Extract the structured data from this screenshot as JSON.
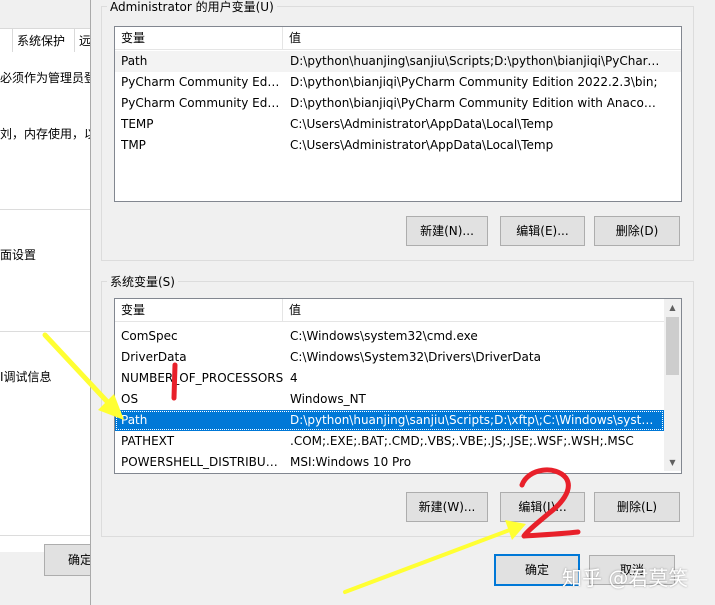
{
  "background_window": {
    "tabs": [
      "",
      "系统保护",
      "远"
    ],
    "admin_notice": "必须作为管理员登",
    "perf_text": "刘，内存使用，以",
    "profile_text": "面设置",
    "debug_text": "I调试信息",
    "ok_label": "确定"
  },
  "user_vars": {
    "title": "Administrator 的用户变量(U)",
    "headers": [
      "变量",
      "值"
    ],
    "rows": [
      {
        "name": "Path",
        "value": "D:\\python\\huanjing\\sanjiu\\Scripts;D:\\python\\bianjiqi\\PyCharm..."
      },
      {
        "name": "PyCharm Community Editi...",
        "value": "D:\\python\\bianjiqi\\PyCharm Community Edition 2022.2.3\\bin;"
      },
      {
        "name": "PyCharm Community Editi...",
        "value": "D:\\python\\bianjiqi\\PyCharm Community Edition with Anacond..."
      },
      {
        "name": "TEMP",
        "value": "C:\\Users\\Administrator\\AppData\\Local\\Temp"
      },
      {
        "name": "TMP",
        "value": "C:\\Users\\Administrator\\AppData\\Local\\Temp"
      }
    ],
    "selected_index": 0,
    "buttons": {
      "new": "新建(N)...",
      "edit": "编辑(E)...",
      "delete": "删除(D)"
    }
  },
  "system_vars": {
    "title": "系统变量(S)",
    "headers": [
      "变量",
      "值"
    ],
    "rows": [
      {
        "name": "ComSpec",
        "value": "C:\\Windows\\system32\\cmd.exe"
      },
      {
        "name": "DriverData",
        "value": "C:\\Windows\\System32\\Drivers\\DriverData"
      },
      {
        "name": "NUMBER_OF_PROCESSORS",
        "value": "4"
      },
      {
        "name": "OS",
        "value": "Windows_NT"
      },
      {
        "name": "Path",
        "value": "D:\\python\\huanjing\\sanjiu\\Scripts;D:\\xftp\\;C:\\Windows\\system..."
      },
      {
        "name": "PATHEXT",
        "value": ".COM;.EXE;.BAT;.CMD;.VBS;.VBE;.JS;.JSE;.WSF;.WSH;.MSC"
      },
      {
        "name": "POWERSHELL_DISTRIBUTI...",
        "value": "MSI:Windows 10 Pro"
      }
    ],
    "selected_index": 4,
    "scroll_fraction": 0.0,
    "buttons": {
      "new": "新建(W)...",
      "edit": "编辑(I)...",
      "delete": "删除(L)"
    }
  },
  "footer": {
    "ok": "确定",
    "cancel": "取消"
  },
  "annotations": {
    "step_number": "2",
    "watermark": "知乎 @君莫笑",
    "arrow_color": "#ffff33",
    "mark_color": "#e8202a"
  }
}
